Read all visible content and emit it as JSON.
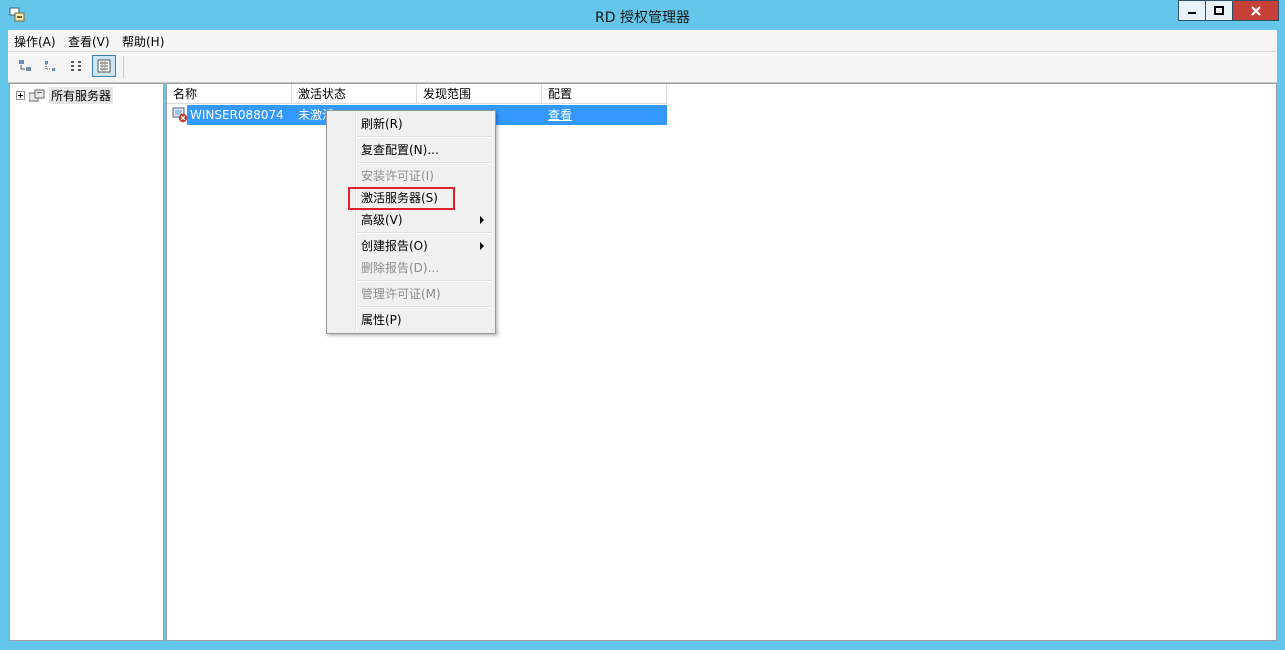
{
  "window": {
    "title": "RD 授权管理器",
    "app_icon": "rd-licensing-icon"
  },
  "menubar": {
    "action": "操作(A)",
    "view": "查看(V)",
    "help": "帮助(H)"
  },
  "toolbar": {
    "buttons": [
      "large-icons-view-icon",
      "small-icons-view-icon",
      "list-view-icon",
      "details-view-icon"
    ],
    "active": "details-view-icon"
  },
  "tree": {
    "root_label": "所有服务器"
  },
  "list": {
    "columns": [
      "名称",
      "激活状态",
      "发现范围",
      "配置"
    ],
    "rows": [
      {
        "name": "WINSER088074",
        "status": "未激活",
        "scope": "",
        "config": "查看",
        "selected": true
      }
    ]
  },
  "context_menu": {
    "items": [
      {
        "label": "刷新(R)",
        "enabled": true
      },
      {
        "label": "复查配置(N)...",
        "enabled": true
      },
      {
        "label": "安装许可证(I)",
        "enabled": false
      },
      {
        "label": "激活服务器(S)",
        "enabled": true,
        "highlighted": true
      },
      {
        "label": "高级(V)",
        "enabled": true,
        "submenu": true
      },
      {
        "label": "创建报告(O)",
        "enabled": true,
        "submenu": true
      },
      {
        "label": "删除报告(D)...",
        "enabled": false
      },
      {
        "label": "管理许可证(M)",
        "enabled": false
      },
      {
        "label": "属性(P)",
        "enabled": true
      }
    ]
  },
  "colors": {
    "titlebar": "#64c6ea",
    "selection": "#3399ff",
    "highlight_box": "#e0202a",
    "close_button": "#c7413a"
  }
}
